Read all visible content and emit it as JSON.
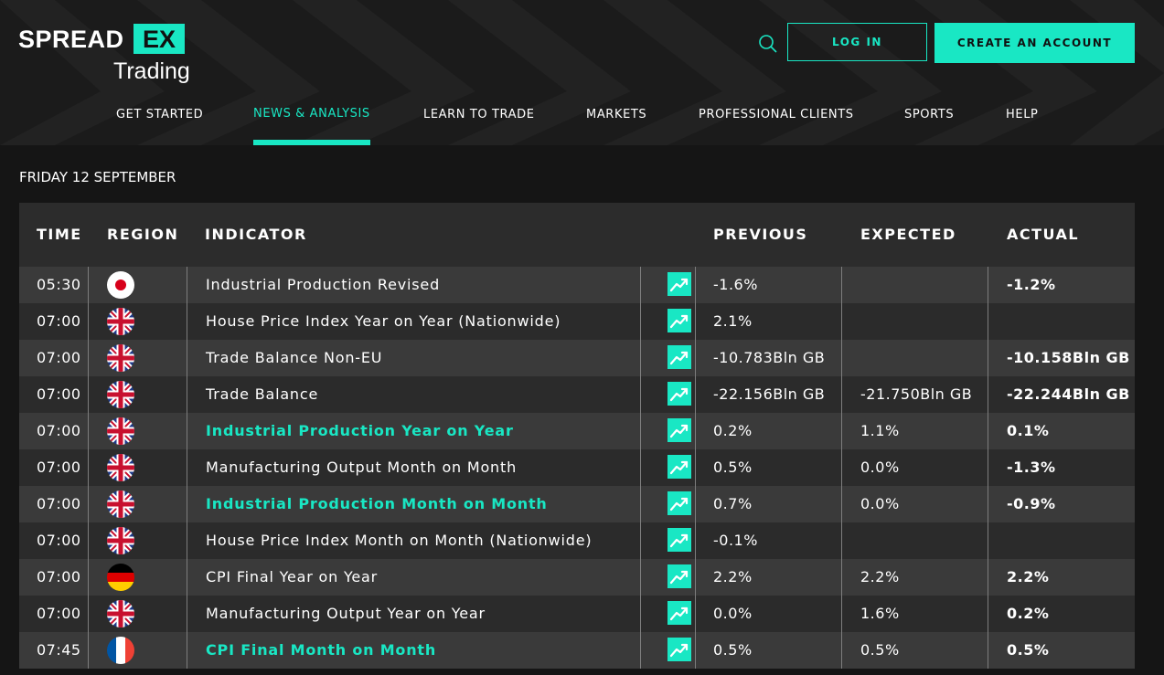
{
  "header": {
    "logo_main": "SPREAD",
    "logo_box": "EX",
    "logo_sub": "Trading",
    "login_label": "LOG IN",
    "create_account_label": "CREATE AN ACCOUNT",
    "accent_color": "#19e7c4"
  },
  "nav": {
    "items": [
      "GET STARTED",
      "NEWS & ANALYSIS",
      "LEARN TO TRADE",
      "MARKETS",
      "PROFESSIONAL CLIENTS",
      "SPORTS",
      "HELP"
    ],
    "active": "NEWS & ANALYSIS"
  },
  "date_label": "FRIDAY 12 SEPTEMBER",
  "table": {
    "headers": {
      "time": "TIME",
      "region": "REGION",
      "indicator": "INDICATOR",
      "previous": "PREVIOUS",
      "expected": "EXPECTED",
      "actual": "ACTUAL"
    },
    "rows": [
      {
        "time": "05:30",
        "region_flag": "japan-flag-icon",
        "indicator": "Industrial Production Revised",
        "highlighted": false,
        "previous": "-1.6%",
        "expected": "",
        "actual": "-1.2%"
      },
      {
        "time": "07:00",
        "region_flag": "uk-flag-icon",
        "indicator": "House Price Index Year on Year (Nationwide)",
        "highlighted": false,
        "previous": "2.1%",
        "expected": "",
        "actual": ""
      },
      {
        "time": "07:00",
        "region_flag": "uk-flag-icon",
        "indicator": "Trade Balance Non-EU",
        "highlighted": false,
        "previous": "-10.783Bln GB",
        "expected": "",
        "actual": "-10.158Bln GB"
      },
      {
        "time": "07:00",
        "region_flag": "uk-flag-icon",
        "indicator": "Trade Balance",
        "highlighted": false,
        "previous": "-22.156Bln GB",
        "expected": "-21.750Bln GB",
        "actual": "-22.244Bln GB"
      },
      {
        "time": "07:00",
        "region_flag": "uk-flag-icon",
        "indicator": "Industrial Production Year on Year",
        "highlighted": true,
        "previous": "0.2%",
        "expected": "1.1%",
        "actual": "0.1%"
      },
      {
        "time": "07:00",
        "region_flag": "uk-flag-icon",
        "indicator": "Manufacturing Output Month on Month",
        "highlighted": false,
        "previous": "0.5%",
        "expected": "0.0%",
        "actual": "-1.3%"
      },
      {
        "time": "07:00",
        "region_flag": "uk-flag-icon",
        "indicator": "Industrial Production Month on Month",
        "highlighted": true,
        "previous": "0.7%",
        "expected": "0.0%",
        "actual": "-0.9%"
      },
      {
        "time": "07:00",
        "region_flag": "uk-flag-icon",
        "indicator": "House Price Index Month on Month (Nationwide)",
        "highlighted": false,
        "previous": "-0.1%",
        "expected": "",
        "actual": ""
      },
      {
        "time": "07:00",
        "region_flag": "germany-flag-icon",
        "indicator": "CPI Final Year on Year",
        "highlighted": false,
        "previous": "2.2%",
        "expected": "2.2%",
        "actual": "2.2%"
      },
      {
        "time": "07:00",
        "region_flag": "uk-flag-icon",
        "indicator": "Manufacturing Output Year on Year",
        "highlighted": false,
        "previous": "0.0%",
        "expected": "1.6%",
        "actual": "0.2%"
      },
      {
        "time": "07:45",
        "region_flag": "france-flag-icon",
        "indicator": "CPI Final Month on Month",
        "highlighted": true,
        "previous": "0.5%",
        "expected": "0.5%",
        "actual": "0.5%"
      }
    ]
  }
}
